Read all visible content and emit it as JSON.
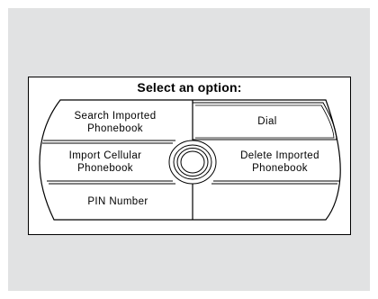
{
  "screen": {
    "title": "Select an option:",
    "options": [
      {
        "label": "Search Imported\nPhonebook",
        "selected": false
      },
      {
        "label": "Dial",
        "selected": true
      },
      {
        "label": "Import Cellular\nPhonebook",
        "selected": false
      },
      {
        "label": "Delete Imported\nPhonebook",
        "selected": false
      },
      {
        "label": "PIN Number",
        "selected": false
      }
    ],
    "center_knob_icon": "interface-dial-icon"
  },
  "colors": {
    "background_panel": "#e1e2e3",
    "screen_background": "#ffffff",
    "lines": "#000000"
  }
}
